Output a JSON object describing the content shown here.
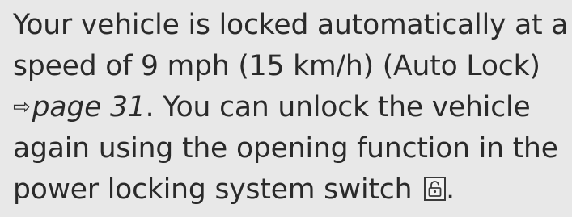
{
  "paragraph": {
    "line1": "Your vehicle is locked automatically at a",
    "line2": "speed of 9 mph (15 km/h) (Auto Lock)",
    "line3_arrow": "⇨",
    "line3_link": "page 31",
    "line3_rest": ". You can unlock the vehicle",
    "line4": "again using the opening function in the",
    "line5_text": "power locking system switch ",
    "line5_end": ".",
    "switch_icon": "unlock-padlock-icon"
  },
  "colors": {
    "background": "#e8e8e8",
    "text": "#2a2a2a"
  }
}
